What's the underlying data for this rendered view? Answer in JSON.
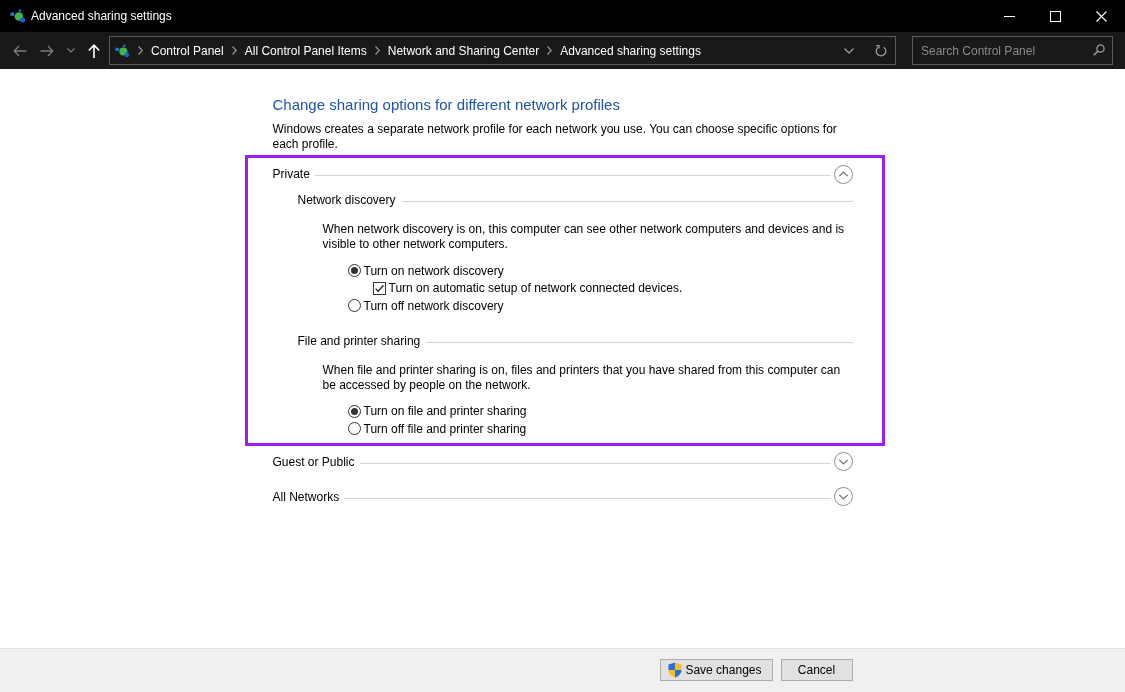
{
  "window": {
    "title": "Advanced sharing settings"
  },
  "nav_buttons": [
    {
      "kind": "back",
      "disabled": true
    },
    {
      "kind": "forward",
      "disabled": true
    },
    {
      "kind": "recent",
      "disabled": true
    },
    {
      "kind": "up",
      "disabled": false
    }
  ],
  "address_bar": {
    "breadcrumbs": [
      "Control Panel",
      "All Control Panel Items",
      "Network and Sharing Center",
      "Advanced sharing settings"
    ]
  },
  "search": {
    "placeholder": "Search Control Panel"
  },
  "content": {
    "heading": "Change sharing options for different network profiles",
    "description": "Windows creates a separate network profile for each network you use. You can choose specific options for each profile.",
    "profiles": [
      {
        "label": "Private",
        "expanded": true,
        "highlighted": true,
        "groups": [
          {
            "heading": "Network discovery",
            "description": "When network discovery is on, this computer can see other network computers and devices and is visible to other network computers.",
            "options": [
              {
                "kind": "radio",
                "label": "Turn on network discovery",
                "selected": true,
                "children": [
                  {
                    "kind": "checkbox",
                    "label": "Turn on automatic setup of network connected devices.",
                    "checked": true
                  }
                ]
              },
              {
                "kind": "radio",
                "label": "Turn off network discovery",
                "selected": false
              }
            ]
          },
          {
            "heading": "File and printer sharing",
            "description": "When file and printer sharing is on, files and printers that you have shared from this computer can be accessed by people on the network.",
            "options": [
              {
                "kind": "radio",
                "label": "Turn on file and printer sharing",
                "selected": true
              },
              {
                "kind": "radio",
                "label": "Turn off file and printer sharing",
                "selected": false
              }
            ]
          }
        ]
      },
      {
        "label": "Guest or Public",
        "expanded": false,
        "highlighted": false
      },
      {
        "label": "All Networks",
        "expanded": false,
        "highlighted": false
      }
    ]
  },
  "buttons": [
    {
      "kind": "shield",
      "label": "Save changes"
    },
    {
      "kind": "plain",
      "label": "Cancel"
    }
  ]
}
